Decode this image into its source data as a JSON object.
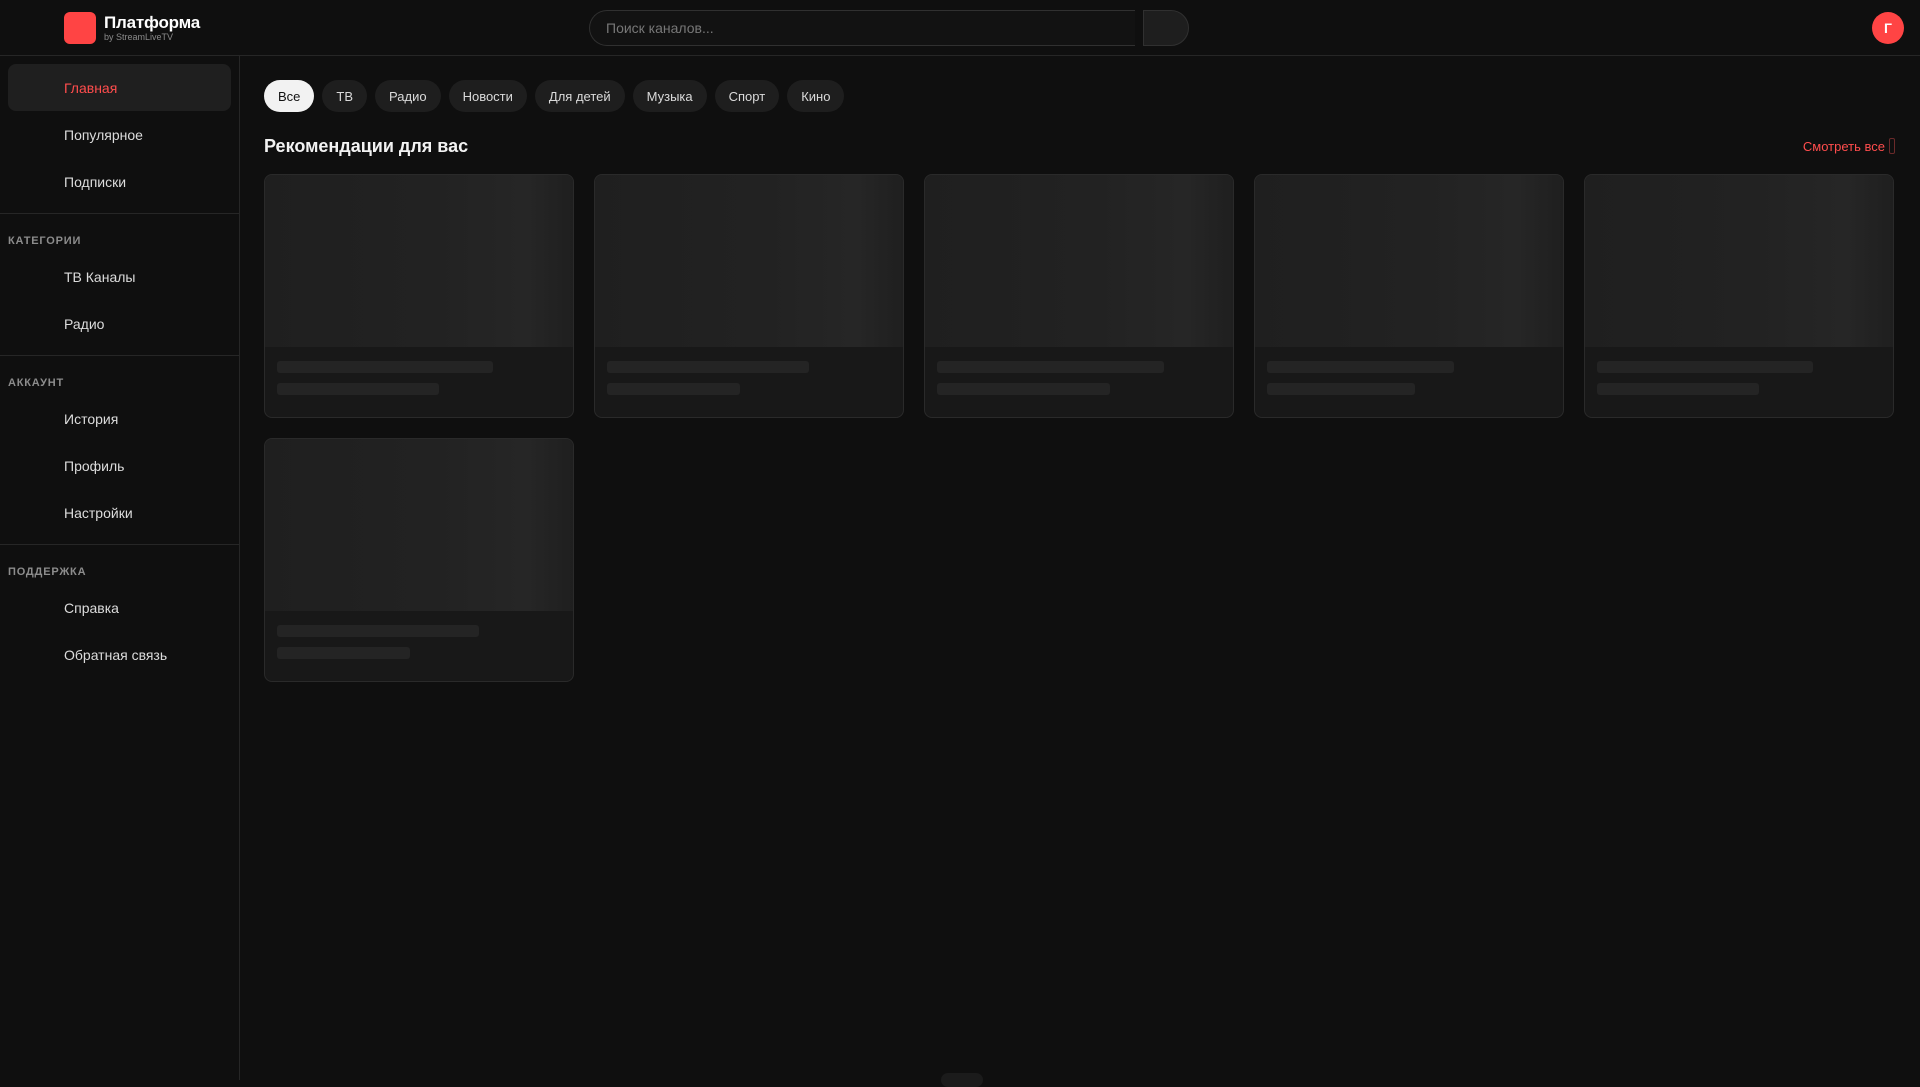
{
  "header": {
    "brand_title": "Платформа",
    "brand_subtitle": "by StreamLiveTV",
    "search_placeholder": "Поиск каналов...",
    "avatar_letter": "Г",
    "accent_color": "#ff4444"
  },
  "sidebar": {
    "main_items": [
      {
        "label": "Главная",
        "active": true
      },
      {
        "label": "Популярное"
      },
      {
        "label": "Подписки"
      }
    ],
    "categories": {
      "heading": "КАТЕГОРИИ",
      "items": [
        {
          "label": "ТВ Каналы"
        },
        {
          "label": "Радио"
        }
      ]
    },
    "account": {
      "heading": "АККАУНТ",
      "items": [
        {
          "label": "История"
        },
        {
          "label": "Профиль"
        },
        {
          "label": "Настройки"
        }
      ]
    },
    "support": {
      "heading": "ПОДДЕРЖКА",
      "items": [
        {
          "label": "Справка"
        },
        {
          "label": "Обратная связь"
        }
      ]
    }
  },
  "main": {
    "chips": [
      {
        "label": "Все",
        "active": true
      },
      {
        "label": "ТВ"
      },
      {
        "label": "Радио"
      },
      {
        "label": "Новости"
      },
      {
        "label": "Для детей"
      },
      {
        "label": "Музыка"
      },
      {
        "label": "Спорт"
      },
      {
        "label": "Кино"
      }
    ],
    "section_title": "Рекомендации для вас",
    "see_all_label": "Смотреть все",
    "placeholder_cards": [
      {
        "line1": 0.76,
        "line2": 0.57
      },
      {
        "line1": 0.71,
        "line2": 0.47
      },
      {
        "line1": 0.8,
        "line2": 0.61
      },
      {
        "line1": 0.66,
        "line2": 0.52
      },
      {
        "line1": 0.76,
        "line2": 0.57
      },
      {
        "line1": 0.71,
        "line2": 0.47
      }
    ]
  }
}
